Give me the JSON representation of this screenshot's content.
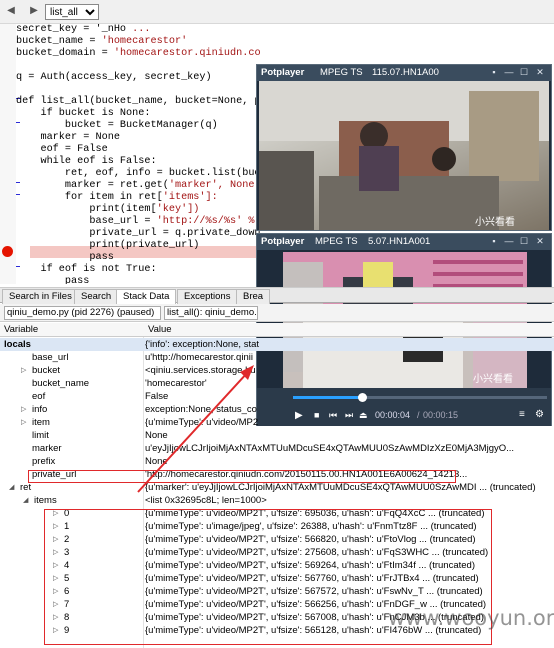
{
  "toolbar": {
    "dropdown_value": "list_all"
  },
  "code": [
    {
      "t": "secret_key = '_nHo",
      "s": " ..."
    },
    {
      "t": "bucket_name = ",
      "s": "'homecarestor'"
    },
    {
      "t": "bucket_domain = ",
      "s": "'homecarestor.qiniudn.com'"
    },
    {
      "t": "",
      "s": ""
    },
    {
      "t": "q = Auth(access_key, secret_key)",
      "s": ""
    },
    {
      "t": "",
      "s": ""
    },
    {
      "t": "def list_all(bucket_name, bucket=None, pre",
      "s": ""
    },
    {
      "t": "    if bucket is None:",
      "s": ""
    },
    {
      "t": "        bucket = BucketManager(q)",
      "s": ""
    },
    {
      "t": "    marker = None",
      "s": ""
    },
    {
      "t": "    eof = False",
      "s": ""
    },
    {
      "t": "    while eof is False:",
      "s": ""
    },
    {
      "t": "        ret, eof, info = bucket.list(bucke",
      "s": ""
    },
    {
      "t": "        marker = ret.get(",
      "s": "'marker', None)"
    },
    {
      "t": "        for item in ret[",
      "s": "'items']:"
    },
    {
      "t": "            print(item[",
      "s": "'key'])"
    },
    {
      "t": "            base_url = ",
      "s": "'http://%s/%s' % ("
    },
    {
      "t": "            private_url = q.private_downlo",
      "s": ""
    },
    {
      "t": "            print(private_url)",
      "s": ""
    },
    {
      "t": "            pass",
      "s": ""
    },
    {
      "t": "    if eof is not True:",
      "s": ""
    },
    {
      "t": "        pass",
      "s": ""
    }
  ],
  "tabs": [
    "Search in Files",
    "Search",
    "Stack Data",
    "Exceptions",
    "Brea"
  ],
  "process_selector": "qiniu_demo.py (pid 2276) (paused)",
  "frame_selector": "list_all(): qiniu_demo.py, l",
  "headers": {
    "variable": "Variable",
    "value": "Value"
  },
  "vars": [
    {
      "n": "locals",
      "v": "{'info': exception:None, stat"
    },
    {
      "n": "base_url",
      "v": "u'http://homecarestor.qinii"
    },
    {
      "n": "bucket",
      "v": "<qiniu.services.storage.bu"
    },
    {
      "n": "bucket_name",
      "v": "'homecarestor'"
    },
    {
      "n": "eof",
      "v": "False"
    },
    {
      "n": "info",
      "v": "exception:None, status_co"
    },
    {
      "n": "item",
      "v": "{u'mimeType': u'video/MP2"
    },
    {
      "n": "limit",
      "v": "None"
    },
    {
      "n": "marker",
      "v": "u'eyJjIjowLCJrIjoiMjAxNTAxMTUuMDcuSE4xQTAwMUU0SzAwMDIzXzE0MjA3MjgyO..."
    },
    {
      "n": "prefix",
      "v": "None"
    },
    {
      "n": "private_url",
      "v": "'http://homecarestor.qiniudn.com/20150115.00.HN1A001E6A00624_14213..."
    },
    {
      "n": "ret",
      "v": "{u'marker': u'eyJjIjowLCJrIjoiMjAxNTAxMTUuMDcuSE4xQTAwMUU0SzAwMDI ... (truncated)"
    },
    {
      "n": "items",
      "v": "<list 0x32695c8L; len=1000>"
    }
  ],
  "items": [
    {
      "i": "0",
      "v": "{u'mimeType': u'video/MP2T', u'fsize': 695036, u'hash': u'FqQ4XcC ... (truncated)"
    },
    {
      "i": "1",
      "v": "{u'mimeType': u'image/jpeg', u'fsize': 26388, u'hash': u'FnmTtz8F ... (truncated)"
    },
    {
      "i": "2",
      "v": "{u'mimeType': u'video/MP2T', u'fsize': 566820, u'hash': u'FtoVlog ... (truncated)"
    },
    {
      "i": "3",
      "v": "{u'mimeType': u'video/MP2T', u'fsize': 275608, u'hash': u'FqS3WHC ... (truncated)"
    },
    {
      "i": "4",
      "v": "{u'mimeType': u'video/MP2T', u'fsize': 569264, u'hash': u'FtIm34f ... (truncated)"
    },
    {
      "i": "5",
      "v": "{u'mimeType': u'video/MP2T', u'fsize': 567760, u'hash': u'FrJTBx4 ... (truncated)"
    },
    {
      "i": "6",
      "v": "{u'mimeType': u'video/MP2T', u'fsize': 567572, u'hash': u'FswNv_T ... (truncated)"
    },
    {
      "i": "7",
      "v": "{u'mimeType': u'video/MP2T', u'fsize': 566256, u'hash': u'FnDGF_w ... (truncated)"
    },
    {
      "i": "8",
      "v": "{u'mimeType': u'video/MP2T', u'fsize': 567008, u'hash': u'FnCJM3b ... (truncated)"
    },
    {
      "i": "9",
      "v": "{u'mimeType': u'video/MP2T', u'fsize': 565128, u'hash': u'FI476bW ... (truncated)"
    }
  ],
  "player1": {
    "app": "Potplayer",
    "format": "MPEG TS",
    "file": "115.07.HN1A00",
    "watermark": "小兴看看"
  },
  "player2": {
    "app": "Potplayer",
    "format": "MPEG TS",
    "file": "5.07.HN1A001",
    "watermark": "小兴看看",
    "time_current": "00:00:04",
    "time_total": "00:00:15",
    "progress": 0.27
  },
  "watermark": "www.wooyun.org"
}
